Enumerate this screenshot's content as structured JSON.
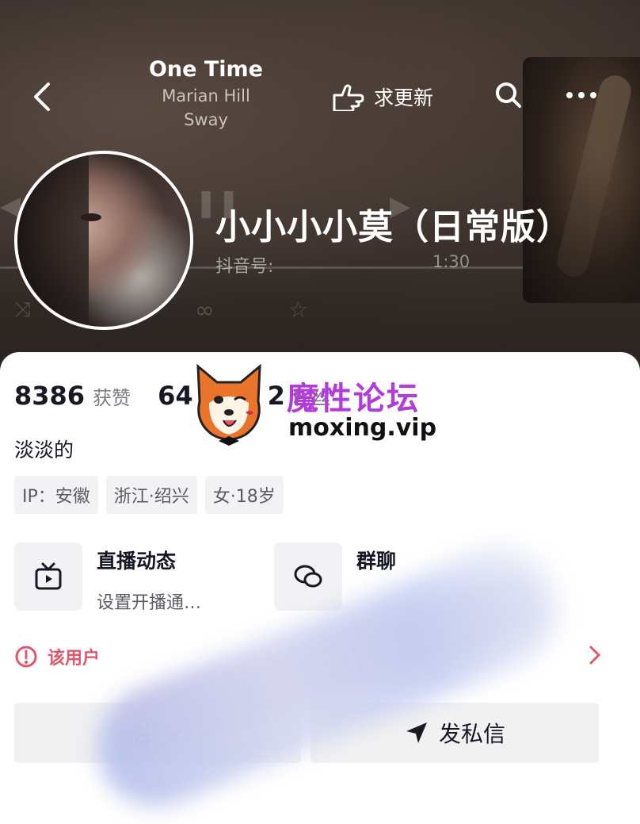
{
  "music": {
    "title": "One Time",
    "artist": "Marian Hill",
    "album": "Sway",
    "duration": "1:30"
  },
  "toolbar": {
    "update_label": "求更新"
  },
  "profile": {
    "nickname": "小小小小莫（日常版）",
    "douyin_id_label": "抖音号:",
    "bio": "淡淡的",
    "stats": [
      {
        "value": "8386",
        "label": "获赞"
      },
      {
        "value": "64",
        "label": ""
      },
      {
        "value": "2",
        "label": "粉丝"
      }
    ],
    "tags": [
      "IP：安徽",
      "浙江·绍兴",
      "女·18岁"
    ]
  },
  "features": {
    "live": {
      "title": "直播动态",
      "subtitle": "设置开播通…"
    },
    "group": {
      "title": "群聊",
      "subtitle": ""
    }
  },
  "notice": {
    "text": "该用户"
  },
  "actions": {
    "follow_label": "注",
    "message_label": "发私信"
  },
  "watermark": {
    "name": "魔性论坛",
    "url": "moxing.vip"
  },
  "colors": {
    "accent_red": "#e0566b",
    "watermark_purple": "#b13cd9",
    "text_primary": "#161823"
  }
}
